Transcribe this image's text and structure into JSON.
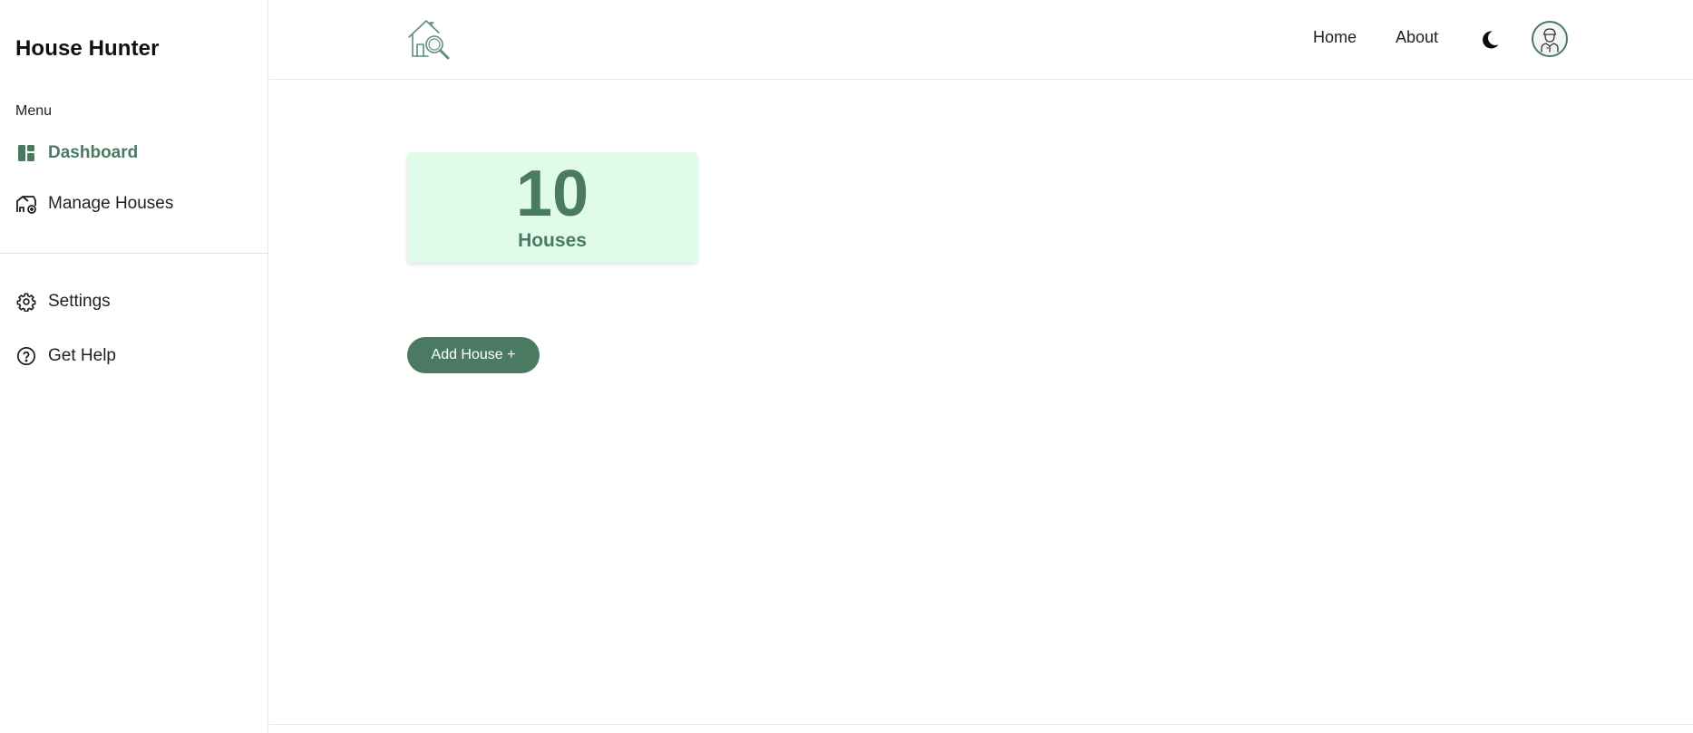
{
  "sidebar": {
    "brand": "House Hunter",
    "menu_label": "Menu",
    "items": [
      {
        "label": "Dashboard",
        "icon": "dashboard-icon",
        "active": true
      },
      {
        "label": "Manage Houses",
        "icon": "house-manage-icon",
        "active": false
      }
    ],
    "bottom_items": [
      {
        "label": "Settings",
        "icon": "gear-icon"
      },
      {
        "label": "Get Help",
        "icon": "help-circle-icon"
      }
    ]
  },
  "header": {
    "logo_icon": "house-search-logo-icon",
    "links": [
      "Home",
      "About"
    ],
    "theme_toggle_icon": "moon-icon",
    "avatar_icon": "user-avatar-icon"
  },
  "main": {
    "stat": {
      "value": "10",
      "label": "Houses"
    },
    "add_button_label": "Add House +"
  },
  "colors": {
    "accent": "#4a7a62",
    "card_background": "#e1fbea"
  }
}
